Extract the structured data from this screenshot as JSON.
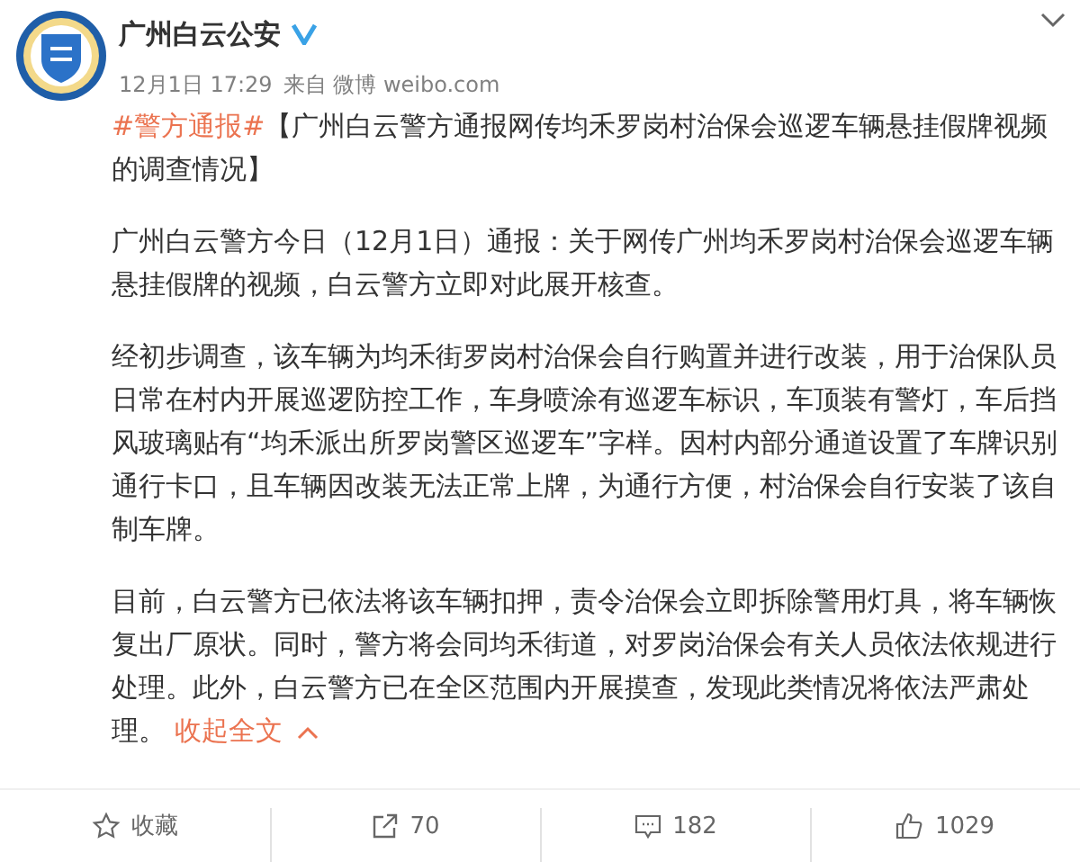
{
  "author": {
    "name": "广州白云公安",
    "verified": true
  },
  "meta": {
    "time": "12月1日 17:29",
    "source": "来自 微博 weibo.com"
  },
  "post": {
    "hashtag": "#警方通报#",
    "title": "【广州白云警方通报网传均禾罗岗村治保会巡逻车辆悬挂假牌视频的调查情况】",
    "paragraphs": [
      "广州白云警方今日（12月1日）通报：关于网传广州均禾罗岗村治保会巡逻车辆悬挂假牌的视频，白云警方立即对此展开核查。",
      "经初步调查，该车辆为均禾街罗岗村治保会自行购置并进行改装，用于治保队员日常在村内开展巡逻防控工作，车身喷涂有巡逻车标识，车顶装有警灯，车后挡风玻璃贴有“均禾派出所罗岗警区巡逻车”字样。因村内部分通道设置了车牌识别通行卡口，且车辆因改装无法正常上牌，为通行方便，村治保会自行安装了该自制车牌。",
      "目前，白云警方已依法将该车辆扣押，责令治保会立即拆除警用灯具，将车辆恢复出厂原状。同时，警方将会同均禾街道，对罗岗治保会有关人员依法依规进行处理。此外，白云警方已在全区范围内开展摸查，发现此类情况将依法严肃处理。"
    ],
    "collapse_link": "收起全文"
  },
  "actions": [
    {
      "kind": "favorite",
      "label": "收藏"
    },
    {
      "kind": "repost",
      "label": "70"
    },
    {
      "kind": "comment",
      "label": "182"
    },
    {
      "kind": "like",
      "label": "1029"
    }
  ]
}
